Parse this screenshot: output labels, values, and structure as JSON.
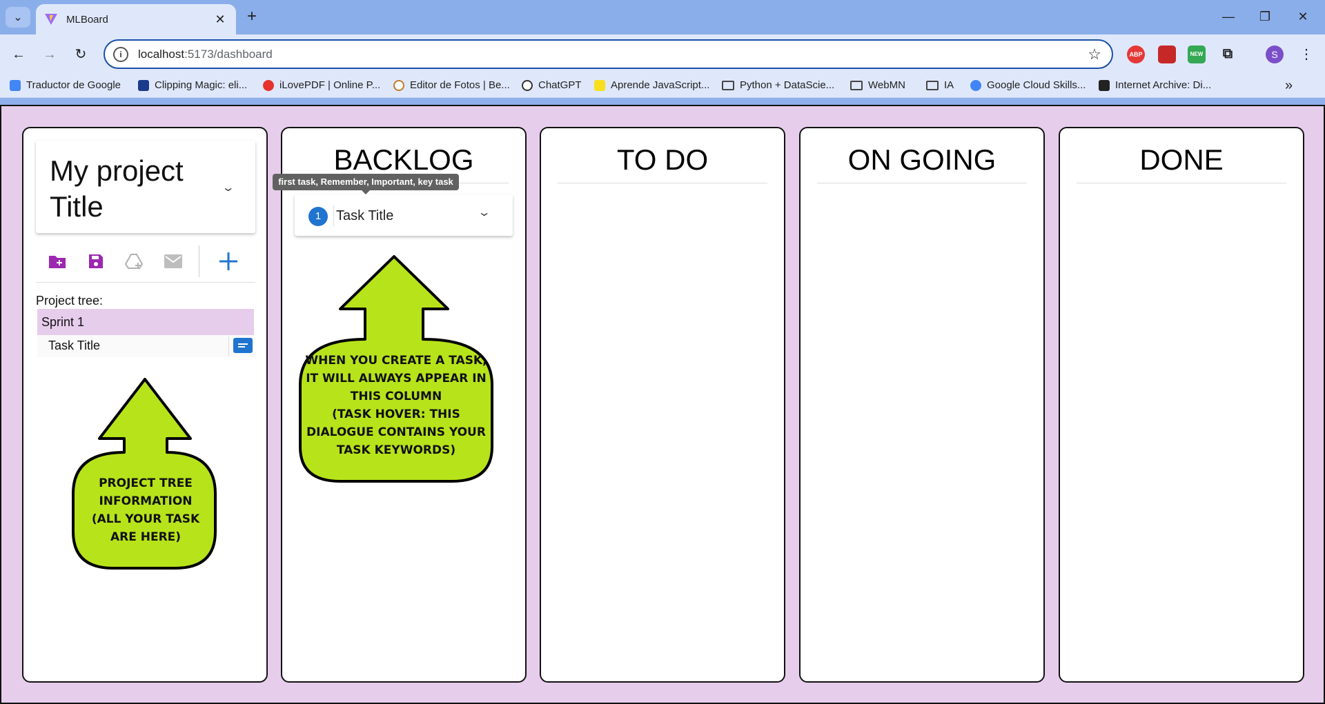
{
  "browser": {
    "tab_title": "MLBoard",
    "url_host": "localhost",
    "url_path": ":5173/dashboard",
    "extensions": [
      "ABP",
      "",
      "NEW"
    ],
    "profile_initial": "S",
    "bookmarks": [
      "Traductor de Google",
      "Clipping Magic: eli...",
      "iLovePDF | Online P...",
      "Editor de Fotos | Be...",
      "ChatGPT",
      "Aprende JavaScript...",
      "Python + DataScie...",
      "WebMN",
      "IA",
      "Google Cloud Skills...",
      "Internet Archive: Di..."
    ]
  },
  "sidebar": {
    "project_title": "My project Title",
    "tools": [
      "new-folder-icon",
      "save-icon",
      "drive-upload-icon",
      "mail-icon",
      "add-icon"
    ],
    "tree_label": "Project tree:",
    "sprint": "Sprint 1",
    "task": "Task Title"
  },
  "columns": {
    "backlog": "BACKLOG",
    "todo": "TO DO",
    "ongoing": "ON GOING",
    "done": "DONE"
  },
  "backlog_task": {
    "number": "1",
    "title": "Task Title",
    "keywords_tooltip": "first task, Remember, Important, key task"
  },
  "callouts": {
    "tree": [
      "PROJECT TREE",
      "INFORMATION",
      "(ALL YOUR TASK",
      "ARE HERE)"
    ],
    "backlog": [
      "WHEN YOU CREATE A TASK,",
      "IT WILL ALWAYS APPEAR IN",
      "THIS COLUMN",
      "(TASK HOVER: THIS",
      "DIALOGUE CONTAINS YOUR",
      "TASK KEYWORDS)"
    ]
  },
  "colors": {
    "accent_purple": "#9c27b0",
    "accent_blue": "#1f74cf",
    "callout_green": "#b7e31a",
    "page_bg": "#e7cdec"
  }
}
